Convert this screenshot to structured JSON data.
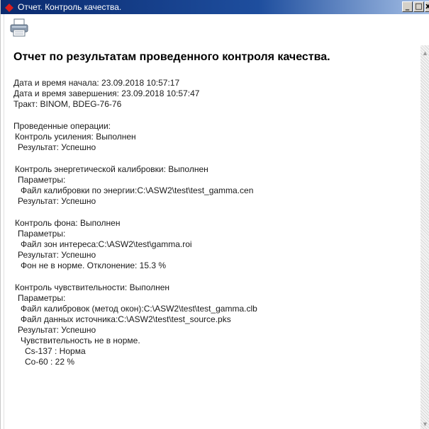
{
  "window": {
    "title": "Отчет. Контроль качества.",
    "controls": {
      "minimize": "_",
      "maximize": "□",
      "close": "x"
    }
  },
  "toolbar": {
    "print_icon": "printer-icon"
  },
  "report": {
    "heading": "Отчет по результатам проведенного контроля качества.",
    "lines": [
      "Дата и время начала: 23.09.2018 10:57:17",
      "Дата и время завершения: 23.09.2018 10:57:47",
      "Тракт: BINOM, BDEG-76-76",
      "Проведенные операции:",
      "Контроль усиления: Выполнен",
      "Результат: Успешно",
      "Контроль энергетической калибровки: Выполнен",
      "Параметры:",
      "Файл калибровки по энергии:C:\\ASW2\\test\\test_gamma.cen",
      "Результат: Успешно",
      "Контроль фона: Выполнен",
      "Параметры:",
      "Файл зон интереса:C:\\ASW2\\test\\gamma.roi",
      "Результат: Успешно",
      "Фон не в норме. Отклонение: 15.3 %",
      "Контроль чувствительности: Выполнен",
      "Параметры:",
      "Файл калибровок (метод окон):C:\\ASW2\\test\\test_gamma.clb",
      "Файл данных источника:C:\\ASW2\\test\\test_source.pks",
      "Результат: Успешно",
      "Чувствительность не в норме.",
      "Cs-137 : Норма",
      "Co-60 : 22 %"
    ]
  }
}
